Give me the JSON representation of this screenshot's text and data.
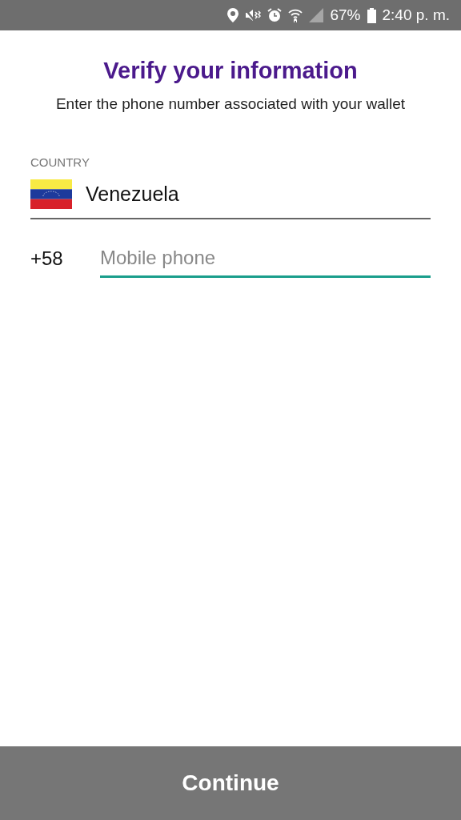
{
  "status_bar": {
    "battery": "67%",
    "time": "2:40 p. m."
  },
  "title": "Verify your information",
  "subtitle": "Enter the phone number associated with your wallet",
  "country": {
    "label": "COUNTRY",
    "value": "Venezuela"
  },
  "phone": {
    "prefix": "+58",
    "placeholder": "Mobile phone",
    "focused": true
  },
  "continue_button": "Continue"
}
